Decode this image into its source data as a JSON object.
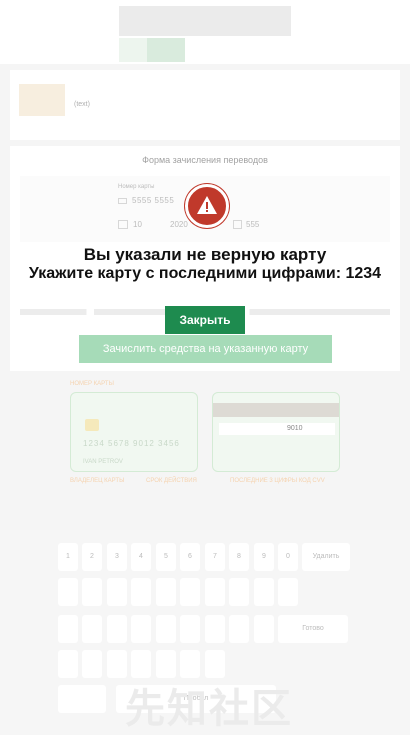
{
  "header": {},
  "info_box": {
    "thumb_text": "(text)"
  },
  "form": {
    "title": "Форма зачисления переводов",
    "card_number_label": "Номер карты",
    "card_number_value": "5555 5555",
    "month_value": "10",
    "year_value": "2020",
    "cvv_value": "555"
  },
  "hint": {
    "number_label": "НОМЕР КАРТЫ",
    "front_number": "1234 5678 9012 3456",
    "front_name": "IVAN PETROV",
    "holder_label": "ВЛАДЕЛЕЦ КАРТЫ",
    "expiry_label": "СРОК ДЕЙСТВИЯ",
    "back_number": "9010",
    "back_label": "ПОСЛЕДНИЕ 3 ЦИФРЫ КОД CVV"
  },
  "keyboard": {
    "digits": [
      "1",
      "2",
      "3",
      "4",
      "5",
      "6",
      "7",
      "8",
      "9",
      "0"
    ],
    "delete_label": "Удалить",
    "done_label": "Готово",
    "space_label": "Пробел"
  },
  "watermark": "先知社区",
  "alert": {
    "title": "Вы указали не верную карту",
    "subtitle": "Укажите карту с последними цифрами: 1234",
    "close_label": "Закрыть",
    "submit_label": "Зачислить средства на указанную карту",
    "accent": "#c0392b",
    "button_color": "#1e8b4f"
  }
}
